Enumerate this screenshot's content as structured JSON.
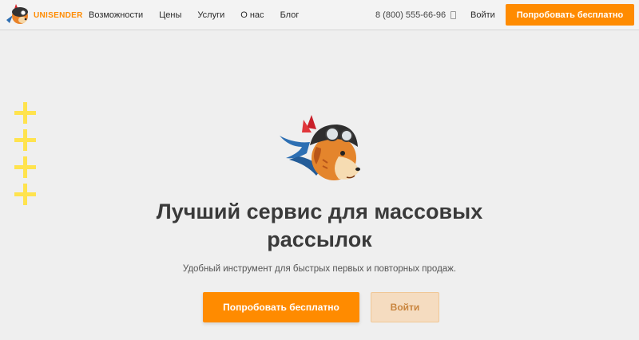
{
  "brand": {
    "name_part1": "UNI",
    "name_part2": "SENDER"
  },
  "nav": {
    "items": [
      {
        "label": "Возможности"
      },
      {
        "label": "Цены"
      },
      {
        "label": "Услуги"
      },
      {
        "label": "О нас"
      },
      {
        "label": "Блог"
      }
    ]
  },
  "header": {
    "phone": "8 (800) 555-66-96",
    "login_label": "Войти",
    "cta_label": "Попробовать бесплатно"
  },
  "hero": {
    "title": "Лучший сервис для массовых рассылок",
    "subtitle": "Удобный инструмент для быстрых первых и повторных продаж.",
    "primary_button": "Попробовать бесплатно",
    "secondary_button": "Войти"
  },
  "colors": {
    "accent": "#ff8b00",
    "background": "#efefef",
    "decor_plus": "#ffe34e"
  }
}
